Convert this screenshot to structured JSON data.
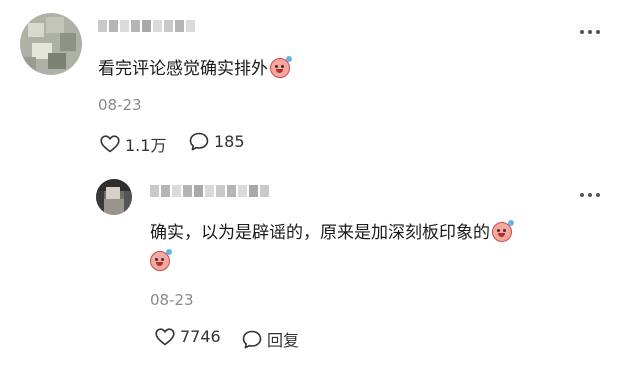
{
  "comments": [
    {
      "text": "看完评论感觉确实排外",
      "emoji": "crying-laughing-emoji",
      "date": "08-23",
      "like_count": "1.1万",
      "reply_count": "185"
    }
  ],
  "reply": {
    "text": "确实，以为是辟谣的，原来是加深刻板印象的",
    "emoji": "crying-laughing-emoji",
    "date": "08-23",
    "like_count": "7746",
    "reply_label": "回复"
  },
  "icons": {
    "like": "heart-outline-icon",
    "comment": "speech-bubble-icon",
    "more": "more-dots-icon"
  }
}
